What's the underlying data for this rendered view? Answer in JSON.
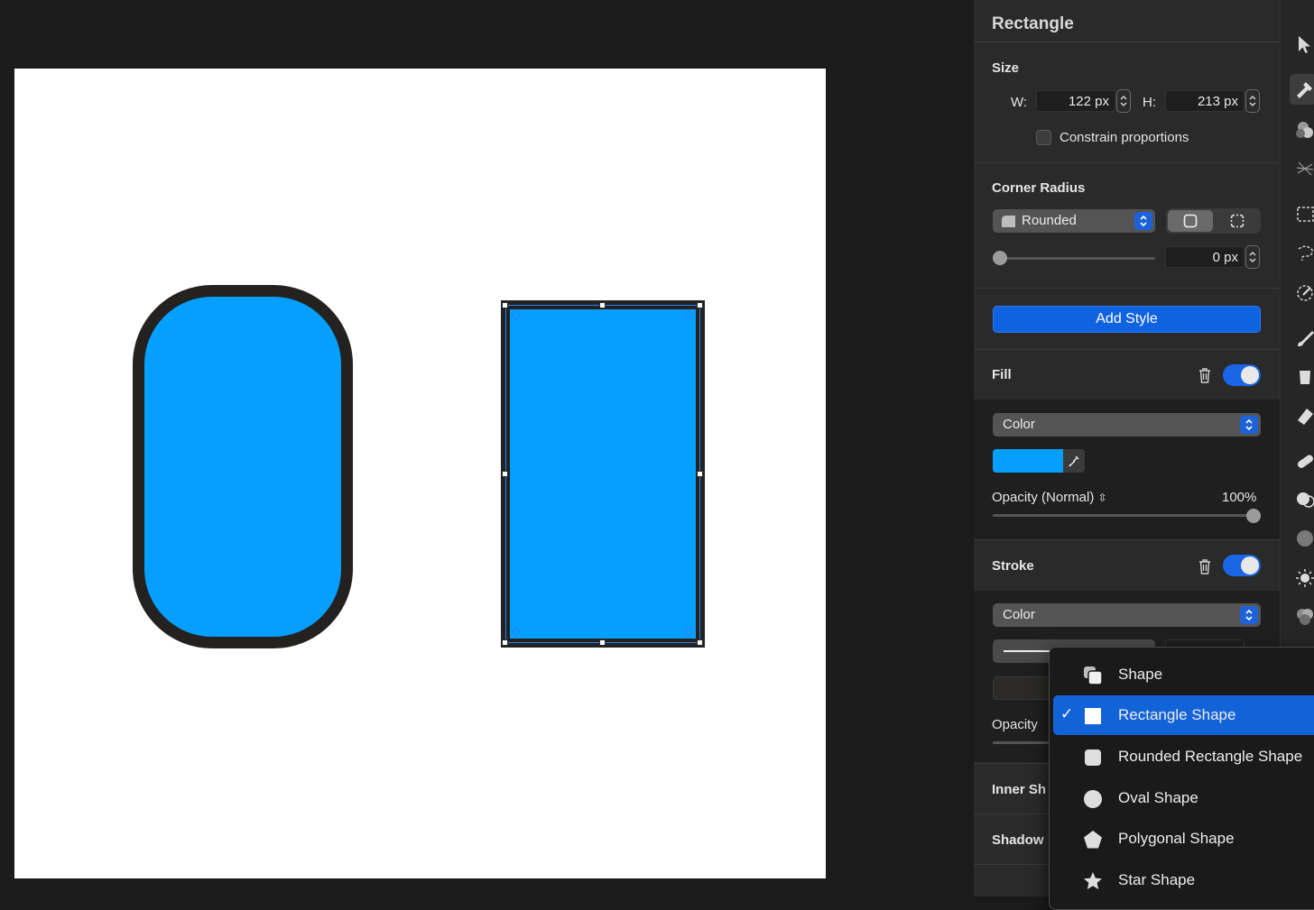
{
  "inspector": {
    "title": "Rectangle",
    "size": {
      "heading": "Size",
      "w_label": "W:",
      "w_value": "122 px",
      "h_label": "H:",
      "h_value": "213 px",
      "constrain_label": "Constrain proportions",
      "constrain_checked": false
    },
    "corner_radius": {
      "heading": "Corner Radius",
      "style_value": "Rounded",
      "radius_value": "0 px",
      "slider_fraction": 0
    },
    "add_style_label": "Add Style",
    "fill": {
      "heading": "Fill",
      "enabled": true,
      "type_value": "Color",
      "color": "#05a0ff",
      "opacity_label": "Opacity (Normal)",
      "opacity_value": "100%",
      "opacity_fraction": 1.0
    },
    "stroke": {
      "heading": "Stroke",
      "enabled": true,
      "type_value": "Color",
      "opacity_label": "Opacity"
    },
    "inner_shadow_heading": "Inner Sh",
    "shadow_heading": "Shadow"
  },
  "canvas": {
    "background": "#ffffff",
    "shape_fill": "#05a0ff",
    "shape_stroke": "#232220"
  },
  "shape_menu": {
    "items": [
      {
        "label": "Shape",
        "icon": "shape-stack-icon",
        "checked": false,
        "highlighted": false
      },
      {
        "label": "Rectangle Shape",
        "icon": "rectangle-icon",
        "checked": true,
        "highlighted": true
      },
      {
        "label": "Rounded Rectangle Shape",
        "icon": "rounded-rectangle-icon",
        "checked": false,
        "highlighted": false
      },
      {
        "label": "Oval Shape",
        "icon": "oval-icon",
        "checked": false,
        "highlighted": false
      },
      {
        "label": "Polygonal Shape",
        "icon": "pentagon-icon",
        "checked": false,
        "highlighted": false
      },
      {
        "label": "Star Shape",
        "icon": "star-icon",
        "checked": false,
        "highlighted": false
      }
    ],
    "check_mark": "✓"
  },
  "tools": [
    "pointer-tool-icon",
    "style-tool-icon",
    "color-adjust-icon",
    "effects-icon",
    "marquee-select-icon",
    "lasso-select-icon",
    "magic-select-icon",
    "brush-icon",
    "paint-bucket-icon",
    "eraser-icon",
    "bandage-icon",
    "clone-icon",
    "noise-icon",
    "light-icon",
    "blend-icon"
  ],
  "accent_color": "#1967e6"
}
